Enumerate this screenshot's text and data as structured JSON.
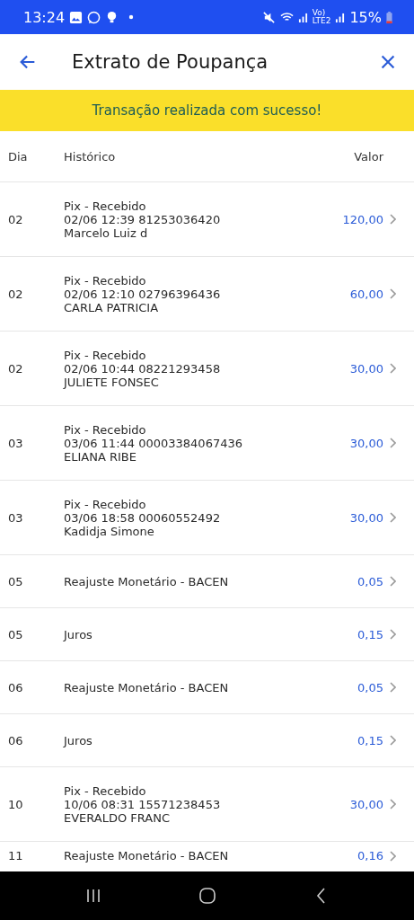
{
  "status_bar": {
    "time": "13:24",
    "volte": [
      "Vo)",
      "LTE2"
    ],
    "battery": "15%"
  },
  "header": {
    "title": "Extrato de Poupança"
  },
  "banner": {
    "text": "Transação realizada com sucesso!"
  },
  "table": {
    "columns": [
      "Dia",
      "Histórico",
      "Valor"
    ],
    "rows": [
      {
        "day": "02",
        "history": [
          "Pix - Recebido",
          "02/06 12:39 81253036420",
          "Marcelo Luiz d"
        ],
        "value": "120,00"
      },
      {
        "day": "02",
        "history": [
          "Pix - Recebido",
          "02/06 12:10 02796396436",
          "CARLA PATRICIA"
        ],
        "value": "60,00"
      },
      {
        "day": "02",
        "history": [
          "Pix - Recebido",
          "02/06 10:44 08221293458",
          "JULIETE FONSEC"
        ],
        "value": "30,00"
      },
      {
        "day": "03",
        "history": [
          "Pix - Recebido",
          "03/06 11:44 00003384067436",
          "ELIANA RIBE"
        ],
        "value": "30,00"
      },
      {
        "day": "03",
        "history": [
          "Pix - Recebido",
          "03/06 18:58 00060552492",
          "Kadidja Simone"
        ],
        "value": "30,00"
      },
      {
        "day": "05",
        "history": [
          "Reajuste Monetário - BACEN"
        ],
        "value": "0,05"
      },
      {
        "day": "05",
        "history": [
          "Juros"
        ],
        "value": "0,15"
      },
      {
        "day": "06",
        "history": [
          "Reajuste Monetário - BACEN"
        ],
        "value": "0,05"
      },
      {
        "day": "06",
        "history": [
          "Juros"
        ],
        "value": "0,15"
      },
      {
        "day": "10",
        "history": [
          "Pix - Recebido",
          "10/06 08:31 15571238453",
          "EVERALDO FRANC"
        ],
        "value": "30,00"
      },
      {
        "day": "11",
        "history": [
          "Reajuste Monetário - BACEN"
        ],
        "value": "0,16"
      }
    ]
  }
}
